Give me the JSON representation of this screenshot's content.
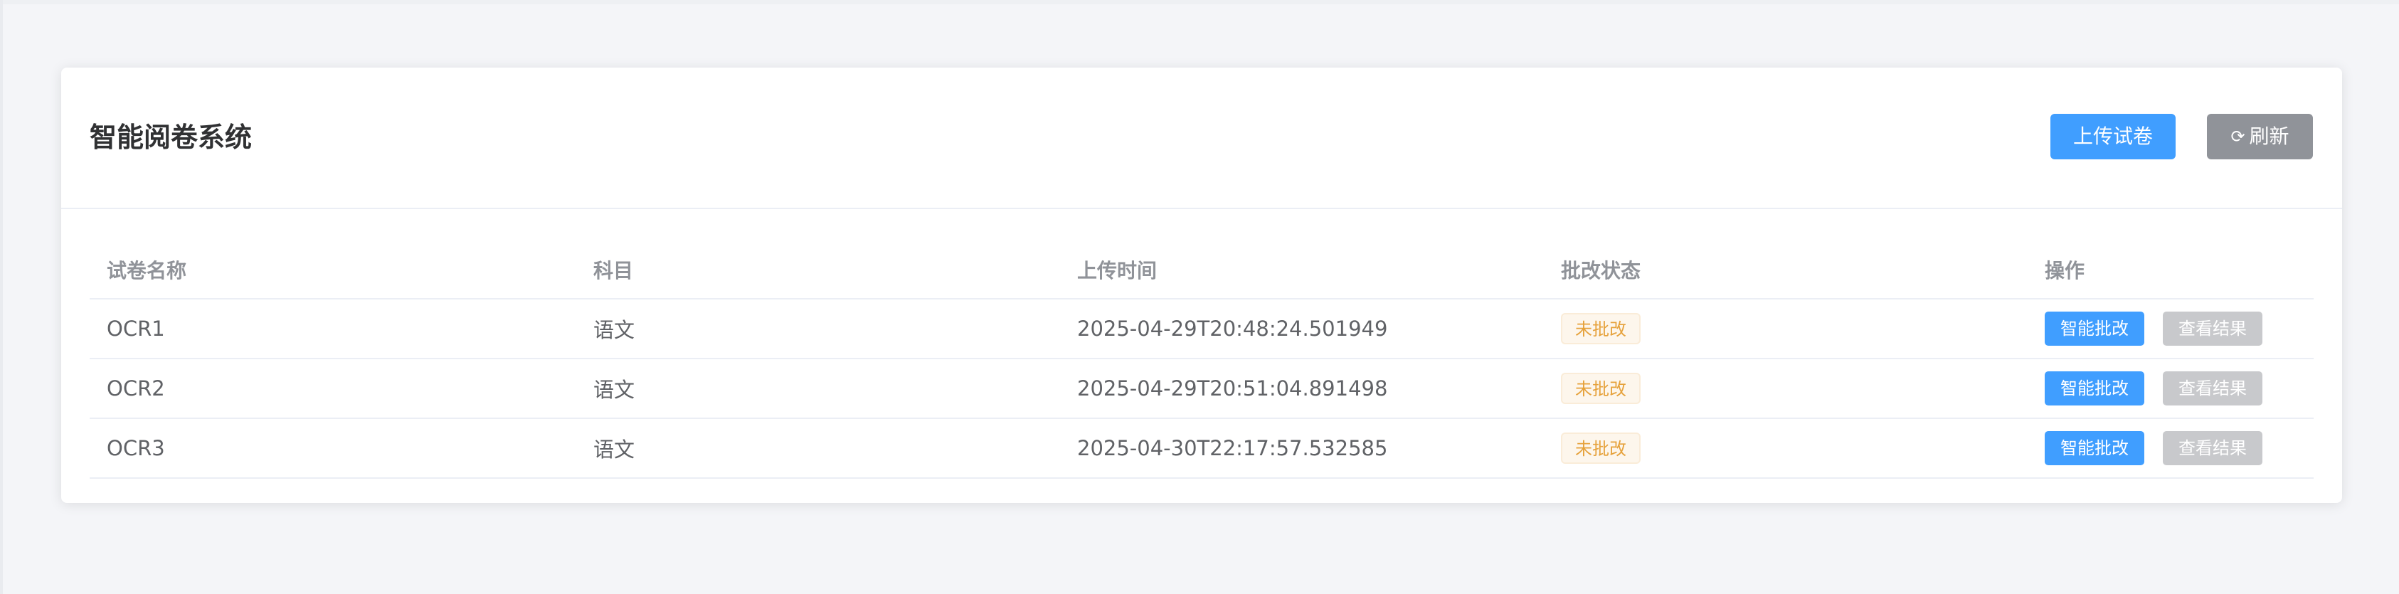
{
  "header": {
    "title": "智能阅卷系统",
    "upload_label": "上传试卷",
    "refresh_icon": "refresh-icon",
    "refresh_label": "刷新"
  },
  "table": {
    "columns": [
      "试卷名称",
      "科目",
      "上传时间",
      "批改状态",
      "操作"
    ],
    "rows": [
      {
        "name": "OCR1",
        "subject": "语文",
        "upload_time": "2025-04-29T20:48:24.501949",
        "status": "未批改",
        "grade_label": "智能批改",
        "view_label": "查看结果"
      },
      {
        "name": "OCR2",
        "subject": "语文",
        "upload_time": "2025-04-29T20:51:04.891498",
        "status": "未批改",
        "grade_label": "智能批改",
        "view_label": "查看结果"
      },
      {
        "name": "OCR3",
        "subject": "语文",
        "upload_time": "2025-04-30T22:17:57.532585",
        "status": "未批改",
        "grade_label": "智能批改",
        "view_label": "查看结果"
      }
    ]
  },
  "colors": {
    "primary": "#409eff",
    "info": "#909399",
    "warning": "#e6a23c",
    "disabled": "#c8c9cc"
  }
}
